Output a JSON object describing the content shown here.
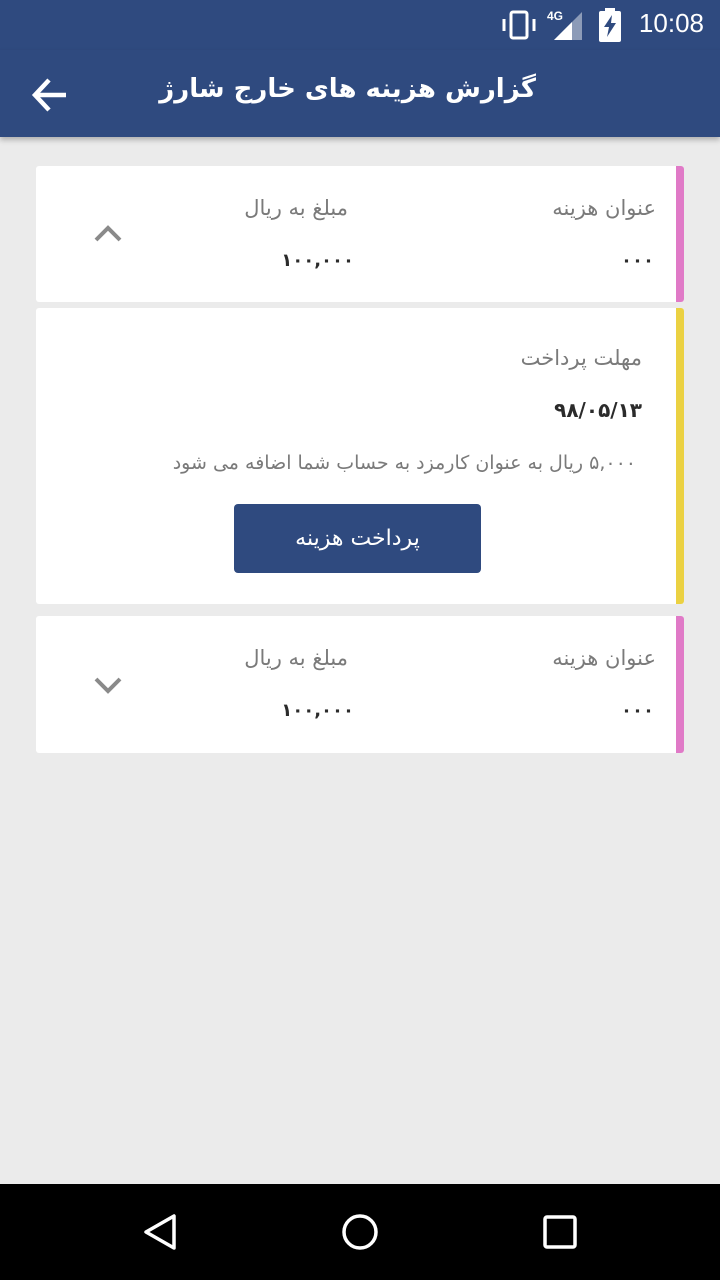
{
  "status_bar": {
    "time": "10:08",
    "network": "4G"
  },
  "app_bar": {
    "title": "گزارش هزینه های خارج شارژ",
    "back_icon": "arrow-left-icon"
  },
  "cards": [
    {
      "title_label": "عنوان هزینه",
      "title_value": "۰۰۰",
      "amount_label": "مبلغ به ریال",
      "amount_value": "۱۰۰,۰۰۰",
      "stripe_color": "#e07ac7",
      "chevron": "chevron-up-icon"
    },
    {
      "deadline_label": "مهلت پرداخت",
      "deadline_value": "۹۸/۰۵/۱۳",
      "fee_note": "۵,۰۰۰ ریال به عنوان کارمزد به حساب شما اضافه می شود",
      "pay_button_label": "پرداخت هزینه",
      "stripe_color": "#ebd142"
    },
    {
      "title_label": "عنوان هزینه",
      "title_value": "۰۰۰",
      "amount_label": "مبلغ به ریال",
      "amount_value": "۱۰۰,۰۰۰",
      "stripe_color": "#e07ac7",
      "chevron": "chevron-down-icon"
    }
  ],
  "colors": {
    "primary": "#2f4a7f",
    "background": "#ebebeb"
  }
}
